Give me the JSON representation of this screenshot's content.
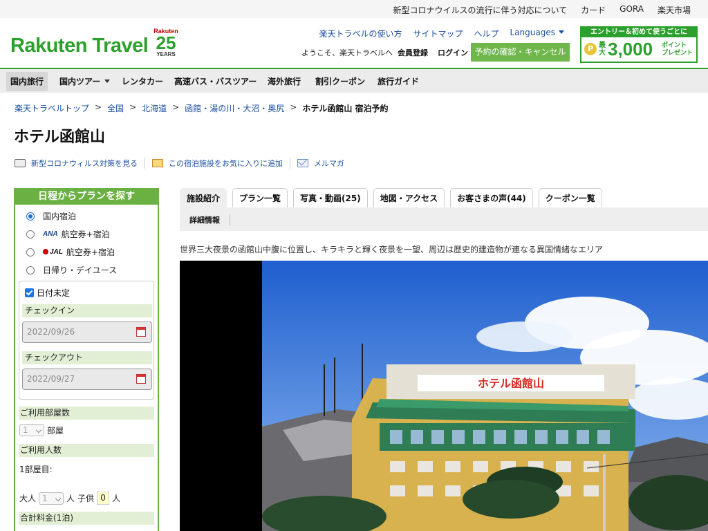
{
  "util_links": [
    "新型コロナウイルスの流行に伴う対応について",
    "カード",
    "GORA",
    "楽天市場"
  ],
  "logo": {
    "text": "Rakuten Travel",
    "anniv_brand": "Rakuten",
    "anniv_number": "25",
    "anniv_years": "YEARS"
  },
  "header_links": {
    "guide": "楽天トラベルの使い方",
    "sitemap": "サイトマップ",
    "help": "ヘルプ",
    "languages": "Languages"
  },
  "welcome": "ようこそ、楽天トラベルへ",
  "member_register": "会員登録",
  "login": "ログイン",
  "reserve_button": "予約の確認・キャンセル",
  "promo": {
    "top": "エントリー＆初めて使うごとに",
    "coin": "P",
    "max": "最大",
    "amount": "3,000",
    "points": "ポイント\nプレゼント"
  },
  "nav": [
    "国内旅行",
    "国内ツアー",
    "レンタカー",
    "高速バス・バスツアー",
    "海外旅行",
    "割引クーポン",
    "旅行ガイド"
  ],
  "breadcrumb": [
    "楽天トラベルトップ",
    "全国",
    "北海道",
    "函館・湯の川・大沼・奥尻",
    "ホテル函館山 宿泊予約"
  ],
  "page_title": "ホテル函館山",
  "actions": [
    "新型コロナウィルス対策を見る",
    "この宿泊施設をお気に入りに追加",
    "メルマガ"
  ],
  "sidebar": {
    "title": "日程からプランを探す",
    "radios": [
      {
        "label": "国内宿泊",
        "brand": ""
      },
      {
        "label": "航空券+宿泊",
        "brand": "ANA"
      },
      {
        "label": "航空券+宿泊",
        "brand": "JAL"
      },
      {
        "label": "日帰り・デイユース",
        "brand": ""
      }
    ],
    "date_undecided": "日付未定",
    "checkin_label": "チェックイン",
    "checkin_value": "2022/09/26",
    "checkout_label": "チェックアウト",
    "checkout_value": "2022/09/27",
    "rooms_label": "ご利用部屋数",
    "rooms_value": "1",
    "rooms_unit": "部屋",
    "people_label": "ご利用人数",
    "room1_label": "1部屋目:",
    "adult_label": "大人",
    "adult_value": "1",
    "person_unit": "人",
    "child_label": "子供",
    "child_value": "0",
    "price_label": "合計料金(1泊)"
  },
  "tabs": [
    "施設紹介",
    "プラン一覧",
    "写真・動画(25)",
    "地図・アクセス",
    "お客さまの声(44)",
    "クーポン一覧"
  ],
  "subtab": "詳細情報",
  "catch_copy": "世界三大夜景の函館山中腹に位置し、キラキラと輝く夜景を一望、周辺は歴史的建造物が連なる異国情緒なエリア",
  "photo": {
    "sign": "ホテル函館山"
  },
  "colors": {
    "brand_green": "#2ca02c",
    "sidebar_green": "#6ab043",
    "link_blue": "#1a4fa0"
  }
}
